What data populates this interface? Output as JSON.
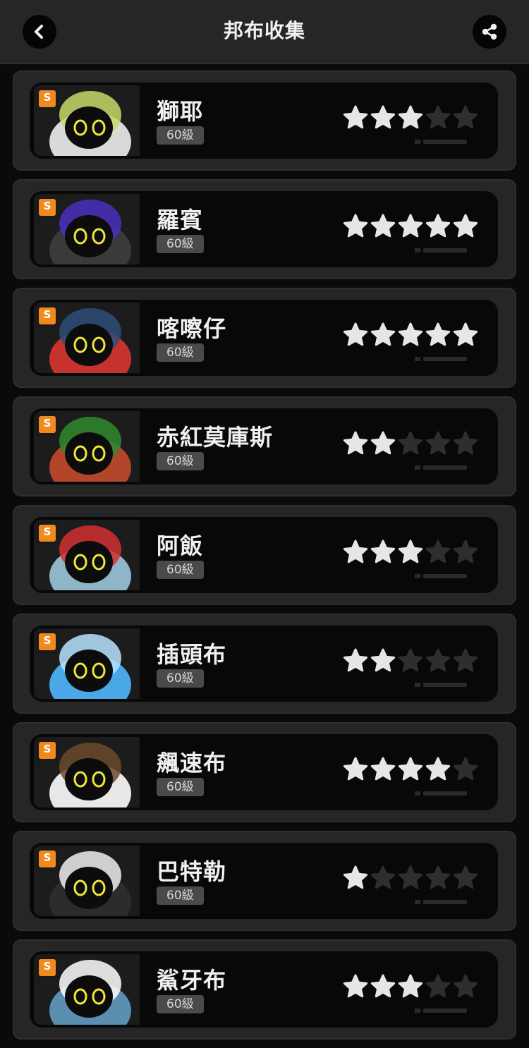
{
  "header": {
    "title": "邦布收集",
    "back_icon": "chevron-left-icon",
    "share_icon": "share-icon"
  },
  "colors": {
    "star_filled": "#e6e6e6",
    "star_empty": "#2e2e2e",
    "rank_badge": "#f08a1e",
    "card_bg": "#262626",
    "inner_bg": "#080808"
  },
  "rank_label": "S",
  "bangboos": [
    {
      "name": "獅耶",
      "level": "60級",
      "stars": 3,
      "max_stars": 5,
      "portrait_color": "#d9d9d9",
      "accent": "#c8d86a"
    },
    {
      "name": "羅賓",
      "level": "60級",
      "stars": 5,
      "max_stars": 5,
      "portrait_color": "#3a3a3a",
      "accent": "#4b2fbf"
    },
    {
      "name": "喀嚓仔",
      "level": "60級",
      "stars": 5,
      "max_stars": 5,
      "portrait_color": "#c8322e",
      "accent": "#2d4d78"
    },
    {
      "name": "赤紅莫庫斯",
      "level": "60級",
      "stars": 2,
      "max_stars": 5,
      "portrait_color": "#b2452a",
      "accent": "#2f8a2f"
    },
    {
      "name": "阿飯",
      "level": "60級",
      "stars": 3,
      "max_stars": 5,
      "portrait_color": "#8fb6c8",
      "accent": "#d23030"
    },
    {
      "name": "插頭布",
      "level": "60級",
      "stars": 2,
      "max_stars": 5,
      "portrait_color": "#4aa8e8",
      "accent": "#b7e3ff"
    },
    {
      "name": "飆速布",
      "level": "60級",
      "stars": 4,
      "max_stars": 5,
      "portrait_color": "#e8e8e8",
      "accent": "#6b4a2a"
    },
    {
      "name": "巴特勒",
      "level": "60級",
      "stars": 1,
      "max_stars": 5,
      "portrait_color": "#2c2c2c",
      "accent": "#eeeeee"
    },
    {
      "name": "鯊牙布",
      "level": "60級",
      "stars": 3,
      "max_stars": 5,
      "portrait_color": "#5a8fb0",
      "accent": "#ffffff"
    }
  ]
}
